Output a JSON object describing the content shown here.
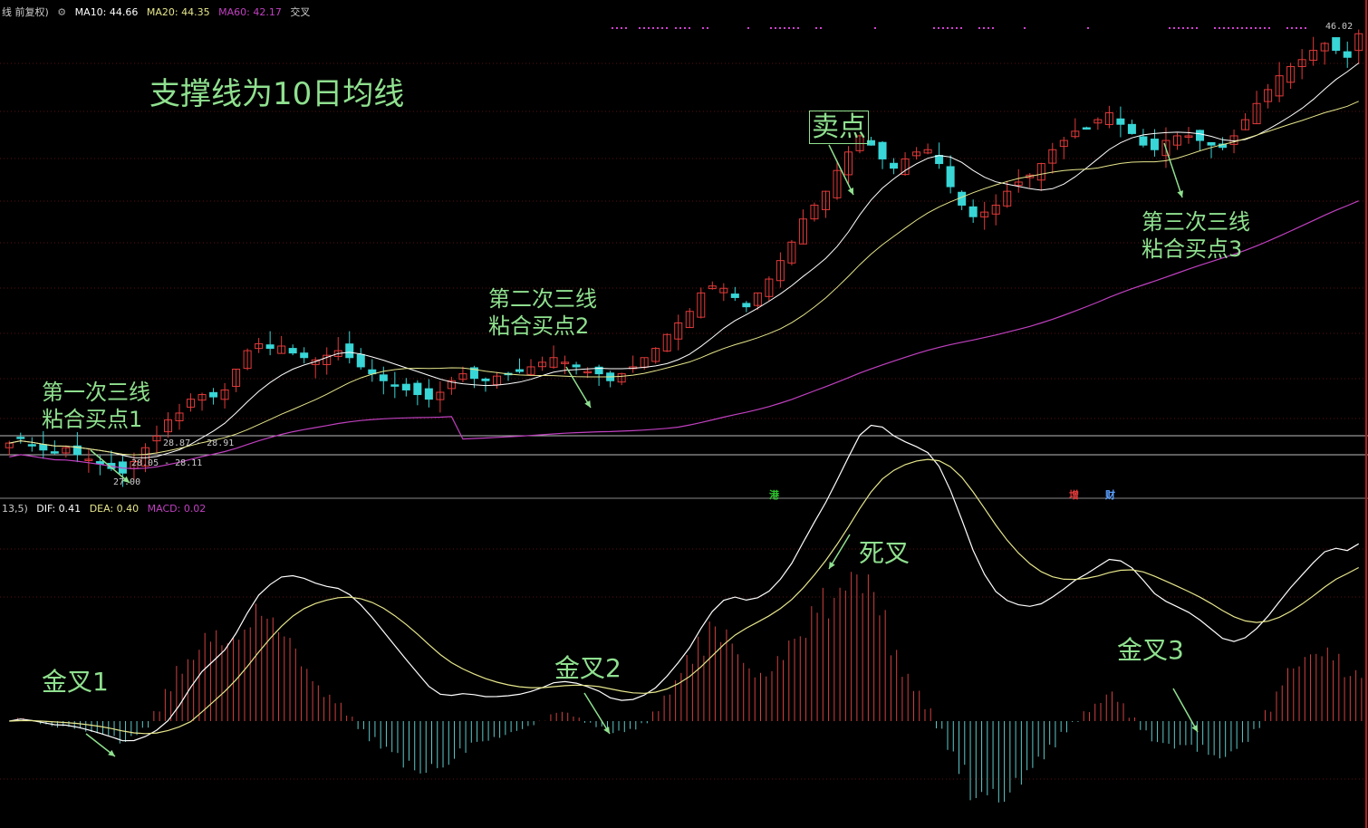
{
  "price_panel": {
    "legend_prefix": "线 前复权)",
    "ma10": "MA10: 44.66",
    "ma20": "MA20: 44.35",
    "ma60": "MA60: 42.17",
    "cross": "交叉",
    "last_price": "46.02",
    "band_high": "28.87 - 28.91",
    "band_mid": "28.05 - 28.11",
    "low_mark": "27.00",
    "chips": [
      "港",
      "增",
      "财"
    ],
    "colors": {
      "up": "#e23a3a",
      "down": "#38d6d6",
      "ma10": "#ffffff",
      "ma20": "#e6e68c",
      "ma60": "#c040c0",
      "annot": "#8fe08f"
    }
  },
  "macd_panel": {
    "legend_prefix": "13,5)",
    "dif": "DIF: 0.41",
    "dea": "DEA: 0.40",
    "macd": "MACD: 0.02"
  },
  "annotations": {
    "title": "支撑线为10日均线",
    "sell": "卖点",
    "buy1": "第一次三线\n粘合买点1",
    "buy2": "第二次三线\n粘合买点2",
    "buy3": "第三次三线\n粘合买点3",
    "golden1": "金叉1",
    "golden2": "金叉2",
    "golden3": "金叉3",
    "death": "死叉"
  },
  "chart_data": [
    {
      "type": "candlestick",
      "y_range": [
        26.5,
        46.5
      ],
      "series_points": 120,
      "closes": [
        28.3,
        28.5,
        28.2,
        28.0,
        27.9,
        28.1,
        27.8,
        27.6,
        27.4,
        27.2,
        27.0,
        27.5,
        28.1,
        28.6,
        29.3,
        29.6,
        30.2,
        30.4,
        30.3,
        30.6,
        31.5,
        32.3,
        32.6,
        32.4,
        32.5,
        32.2,
        32.0,
        31.9,
        32.1,
        32.3,
        32.0,
        31.6,
        31.3,
        31.0,
        30.8,
        30.6,
        30.4,
        30.2,
        30.5,
        31.0,
        31.3,
        31.1,
        31.0,
        31.2,
        31.3,
        31.4,
        31.6,
        31.8,
        32.0,
        31.8,
        31.6,
        31.4,
        31.3,
        31.0,
        31.3,
        31.6,
        32.0,
        32.4,
        33.0,
        33.5,
        34.0,
        34.8,
        35.1,
        35.0,
        34.6,
        34.2,
        34.8,
        35.4,
        36.2,
        37.0,
        38.0,
        38.6,
        39.2,
        40.1,
        40.9,
        41.6,
        41.2,
        40.6,
        40.2,
        40.6,
        40.9,
        41.0,
        40.4,
        39.4,
        38.6,
        38.1,
        38.3,
        38.6,
        39.2,
        39.6,
        39.9,
        40.4,
        41.0,
        41.4,
        41.8,
        41.9,
        42.3,
        42.6,
        42.1,
        41.7,
        41.2,
        41.0,
        41.4,
        41.6,
        41.6,
        41.4,
        41.2,
        41.1,
        41.6,
        42.3,
        43.0,
        43.6,
        44.2,
        44.6,
        44.9,
        45.3,
        45.6,
        45.3,
        45.0,
        46.02
      ],
      "ma10_label": "MA10",
      "ma20_label": "MA20",
      "ma60_label": "MA60"
    },
    {
      "type": "macd",
      "y_range": [
        -1.3,
        1.6
      ]
    }
  ]
}
